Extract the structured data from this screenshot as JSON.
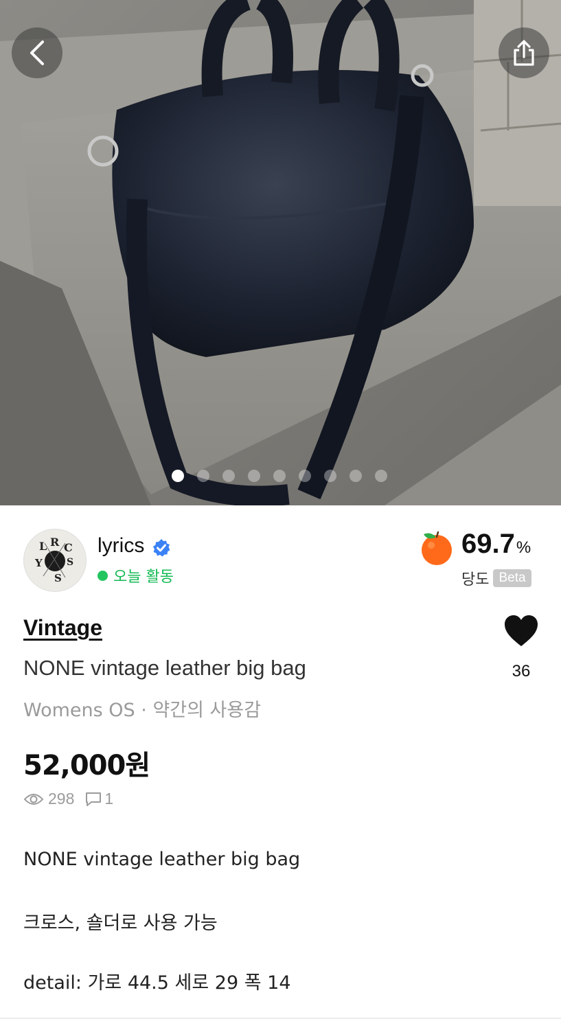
{
  "seller": {
    "name": "lyrics",
    "status": "오늘 활동"
  },
  "sweetness": {
    "value": "69.7",
    "unit": "%",
    "label": "당도",
    "badge": "Beta"
  },
  "product": {
    "category": "Vintage",
    "title": "NONE vintage leather big bag",
    "condition": "Womens OS · 약간의 사용감",
    "price": "52,000원",
    "views": "298",
    "chats": "1",
    "likes": "36"
  },
  "description": [
    "NONE vintage leather big bag",
    "크로스, 숄더로 사용 가능",
    "detail: 가로 44.5 세로 29 폭 14"
  ],
  "gallery": {
    "image_count": 9,
    "current_index": 1
  },
  "colors": {
    "status_green": "#13b953",
    "verified_blue": "#3b82f6",
    "heart": "#111111",
    "muted_text": "#9a9a9a"
  },
  "icons": {
    "back": "chevron-left-icon",
    "share": "share-icon",
    "verified": "verified-badge-icon",
    "fruit": "orange-fruit-icon",
    "like": "heart-icon",
    "views": "eye-icon",
    "chats": "chat-bubble-icon"
  }
}
